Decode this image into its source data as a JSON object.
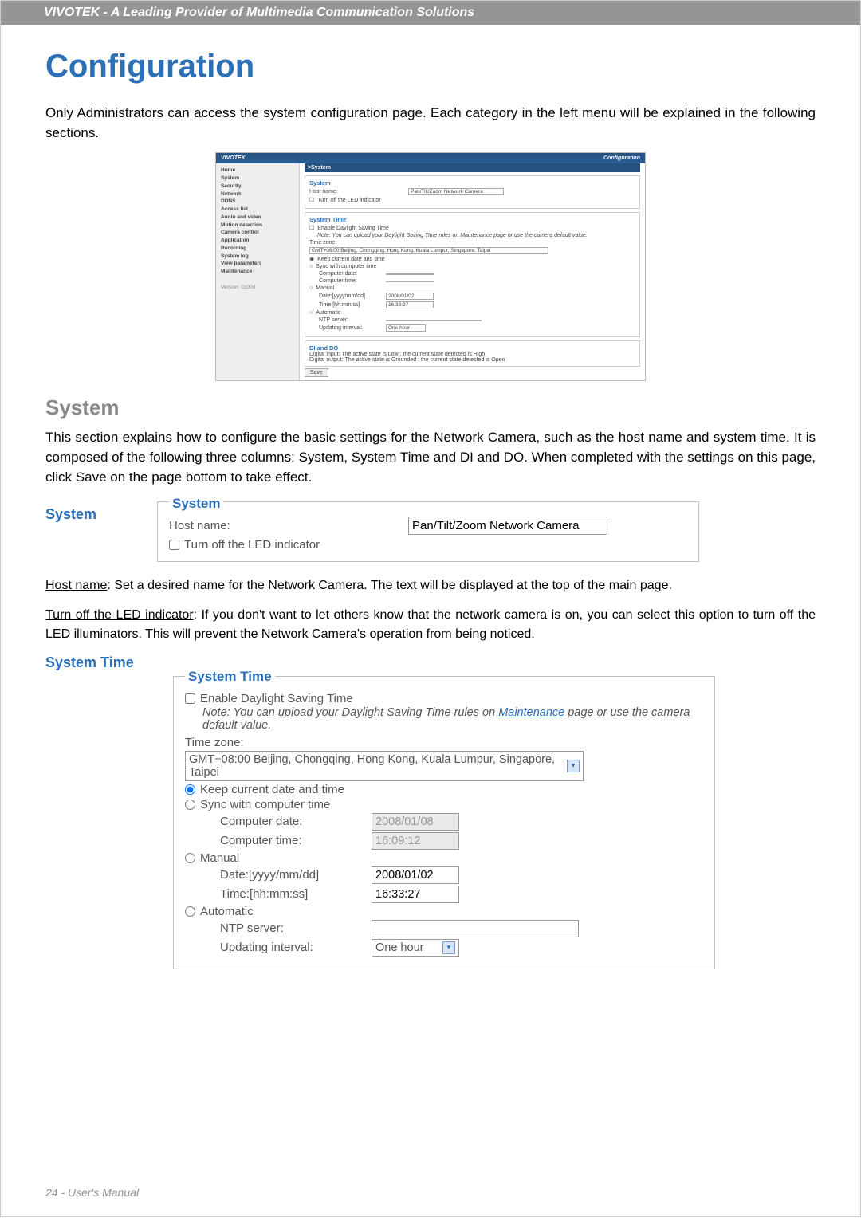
{
  "header": "VIVOTEK - A Leading Provider of Multimedia Communication Solutions",
  "title": "Configuration",
  "lead": "Only Administrators can access the system configuration page. Each category in the left menu will be explained in the following sections.",
  "mini_screenshot": {
    "brand": "VIVOTEK",
    "right": "Configuration",
    "nav": [
      "Home",
      "System",
      "Security",
      "Network",
      "DDNS",
      "Access list",
      "Audio and video",
      "Motion detection",
      "Camera control",
      "Application",
      "Recording",
      "System log",
      "View parameters",
      "Maintenance"
    ],
    "version": "Version: 0100d",
    "bar": ">System",
    "fs1_title": "System",
    "host_label": "Host name:",
    "host_value": "Pan/Tilt/Zoom Network Camera",
    "led_label": "Turn off the LED indicator",
    "fs2_title": "System Time",
    "dst_label": "Enable Daylight Saving Time",
    "dst_note": "Note: You can upload your Daylight Saving Time rules on Maintenance page or use the camera default value.",
    "tz_label": "Time zone:",
    "tz_value": "GMT+08:00 Beijing, Chongqing, Hong Kong, Kuala Lumpur, Singapore, Taipei",
    "opt_keep": "Keep current date and time",
    "opt_sync": "Sync with computer time",
    "comp_date_label": "Computer date:",
    "comp_time_label": "Computer time:",
    "opt_manual": "Manual",
    "manual_date_label": "Date:[yyyy/mm/dd]",
    "manual_date_value": "2008/01/02",
    "manual_time_label": "Time:[hh:mm:ss]",
    "manual_time_value": "16:33:27",
    "opt_auto": "Automatic",
    "ntp_label": "NTP server:",
    "interval_label": "Updating interval:",
    "interval_value": "One hour",
    "fs3_title": "DI and DO",
    "di_line": "Digital input: The active state is Low ; the current state detected is High",
    "do_line": "Digital output: The active state is Grounded ; the current state detected is Open",
    "save": "Save"
  },
  "section_heading": "System",
  "section_body": "This section explains how to configure the basic settings for the Network Camera, such as the host name and system time. It is composed of the following three columns: System, System Time and DI and DO. When completed with the settings on this page, click Save on the page bottom to take effect.",
  "sub_system": "System",
  "system_callout": {
    "legend": "System",
    "host_label": "Host name:",
    "host_value": "Pan/Tilt/Zoom Network Camera",
    "led_label": "Turn off the LED indicator"
  },
  "host_para_label": "Host name",
  "host_para": ": Set a desired name for the Network Camera. The text will be displayed at the top of the main page.",
  "led_para_label": "Turn off the LED indicator",
  "led_para": ": If you don't want to let others know that the network camera is on, you can select this option to turn off the LED illuminators. This will prevent the Network Camera's operation from being noticed.",
  "sub_systime": "System Time",
  "systime_callout": {
    "legend": "System Time",
    "dst_label": "Enable Daylight Saving Time",
    "note_pre": "Note: You can upload your Daylight Saving Time rules on ",
    "note_link": "Maintenance",
    "note_post": " page or use the camera default value.",
    "tz_label": "Time zone:",
    "tz_value": "GMT+08:00 Beijing, Chongqing, Hong Kong, Kuala Lumpur, Singapore, Taipei",
    "opt_keep": "Keep current date and time",
    "opt_sync": "Sync with computer time",
    "comp_date_label": "Computer date:",
    "comp_date_value": "2008/01/08",
    "comp_time_label": "Computer time:",
    "comp_time_value": "16:09:12",
    "opt_manual": "Manual",
    "manual_date_label": "Date:[yyyy/mm/dd]",
    "manual_date_value": "2008/01/02",
    "manual_time_label": "Time:[hh:mm:ss]",
    "manual_time_value": "16:33:27",
    "opt_auto": "Automatic",
    "ntp_label": "NTP server:",
    "ntp_value": "",
    "interval_label": "Updating interval:",
    "interval_value": "One hour"
  },
  "footer": "24 - User's Manual"
}
